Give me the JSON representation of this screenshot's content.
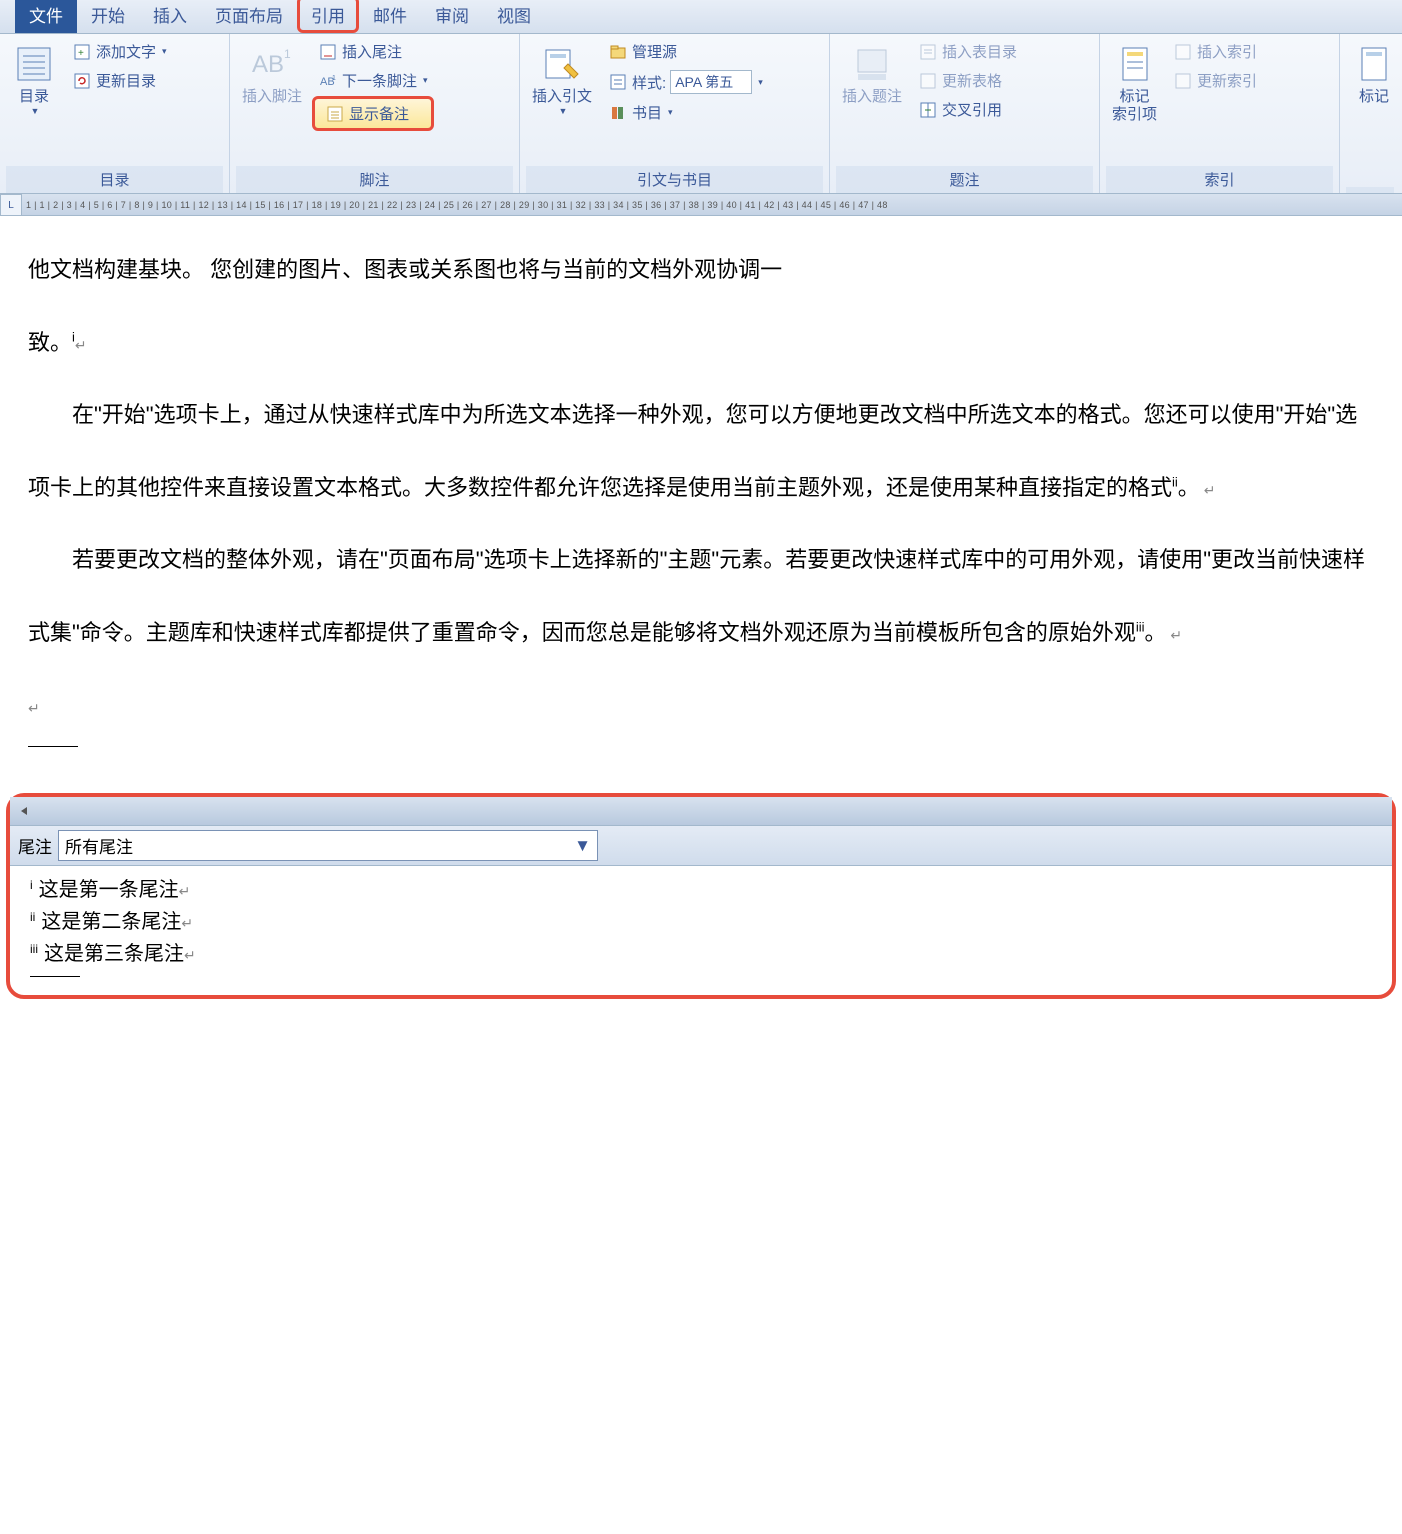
{
  "tabs": {
    "file": "文件",
    "home": "开始",
    "insert": "插入",
    "pageLayout": "页面布局",
    "references": "引用",
    "mailings": "邮件",
    "review": "审阅",
    "view": "视图"
  },
  "ribbon": {
    "toc": {
      "label": "目录",
      "tocBtn": "目录",
      "addText": "添加文字",
      "updateToc": "更新目录"
    },
    "footnotes": {
      "label": "脚注",
      "insertFootnote": "插入脚注",
      "insertEndnote": "插入尾注",
      "nextFootnote": "下一条脚注",
      "showNotes": "显示备注"
    },
    "citations": {
      "label": "引文与书目",
      "insertCitation": "插入引文",
      "manageSources": "管理源",
      "styleLabel": "样式:",
      "styleValue": "APA 第五",
      "bibliography": "书目"
    },
    "captions": {
      "label": "题注",
      "insertCaption": "插入题注",
      "insertTof": "插入表目录",
      "updateTable": "更新表格",
      "crossRef": "交叉引用"
    },
    "index": {
      "label": "索引",
      "markEntry": "标记\n索引项",
      "insertIndex": "插入索引",
      "updateIndex": "更新索引"
    },
    "toa": {
      "label": "",
      "markCitation": "标记"
    }
  },
  "ruler": "1 | 1 | 2 | 3 | 4 | 5 | 6 | 7 | 8 | 9 | 10 | 11 | 12 | 13 | 14 | 15 | 16 | 17 | 18 | 19 | 20 | 21 | 22 | 23 | 24 | 25 | 26 | 27 | 28 | 29 | 30 | 31 | 32 | 33 | 34 | 35 | 36 | 37 | 38 | 39 | 40 | 41 | 42 | 43 | 44 | 45 | 46 | 47 | 48",
  "document": {
    "p1_part1": "他文档构建基块。 您创建的图片、图表或关系图也将与当前的文档外观协调一",
    "p1_part2": "致。",
    "ref1": "i",
    "p2": "在\"开始\"选项卡上，通过从快速样式库中为所选文本选择一种外观，您可以方便地更改文档中所选文本的格式。您还可以使用\"开始\"选项卡上的其他控件来直接设置文本格式。大多数控件都允许您选择是使用当前主题外观，还是使用某种直接指定的格式",
    "ref2": "ii",
    "p2_end": "。",
    "p3": "若要更改文档的整体外观，请在\"页面布局\"选项卡上选择新的\"主题\"元素。若要更改快速样式库中的可用外观，请使用\"更改当前快速样式集\"命令。主题库和快速样式库都提供了重置命令，因而您总是能够将文档外观还原为当前模板所包含的原始外观",
    "ref3": "iii",
    "p3_end": "。"
  },
  "footnotePane": {
    "headerLabel": "尾注",
    "selectValue": "所有尾注",
    "notes": [
      {
        "ref": "i",
        "text": "这是第一条尾注"
      },
      {
        "ref": "ii",
        "text": "这是第二条尾注"
      },
      {
        "ref": "iii",
        "text": "这是第三条尾注"
      }
    ]
  }
}
